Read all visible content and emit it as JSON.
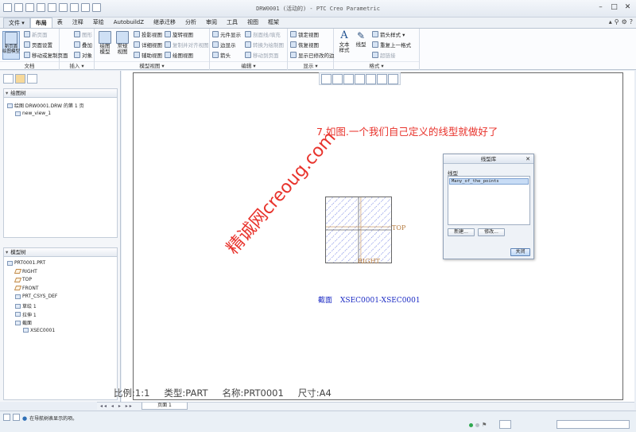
{
  "window": {
    "title": "DRW0001 (活动的) - PTC Creo Parametric"
  },
  "menu_tabs": [
    {
      "label": "文件 ▾",
      "state": "file"
    },
    {
      "label": "布局",
      "state": "active"
    },
    {
      "label": "表",
      "state": ""
    },
    {
      "label": "注释",
      "state": ""
    },
    {
      "label": "草绘",
      "state": ""
    },
    {
      "label": "AutobuildZ",
      "state": ""
    },
    {
      "label": "继承迁移",
      "state": ""
    },
    {
      "label": "分析",
      "state": ""
    },
    {
      "label": "审阅",
      "state": ""
    },
    {
      "label": "工具",
      "state": ""
    },
    {
      "label": "视图",
      "state": ""
    },
    {
      "label": "框架",
      "state": ""
    }
  ],
  "ribbon": {
    "doc_group": {
      "label": "文档",
      "big": "新页面\n绘图模型",
      "items": [
        "新页面",
        "页面设置",
        "移动或复制页面"
      ]
    },
    "insert_group": {
      "label": "插入 ▾",
      "items": [
        "图形",
        "叠加",
        "对象"
      ]
    },
    "model_views_group": {
      "label": "模型视图 ▾",
      "big1": "绘图\n模型",
      "big2": "常规\n视图",
      "items": [
        "投影视图",
        "旋转视图",
        "详细视图",
        "复制并对齐视图",
        "辅助视图",
        "绘图视图"
      ]
    },
    "edit_group": {
      "label": "编辑 ▾",
      "items": [
        "元件显示",
        "箭头",
        "边显示",
        "转换为绘制图",
        "剖面线/填充",
        "移动到页面"
      ]
    },
    "display_group": {
      "label": "显示 ▾",
      "items": [
        "锁定视图",
        "恢复视图",
        "显示已修改的边"
      ]
    },
    "format_group": {
      "label": "格式 ▾",
      "big1": "文本\n样式",
      "big2": "线型",
      "items": [
        "箭头样式 ▾",
        "重复上一格式",
        "超链接"
      ]
    }
  },
  "drawing_tree": {
    "header": "绘图树",
    "items": [
      "绘图 DRW0001.DRW 的第 1 页",
      "new_view_1"
    ]
  },
  "model_tree": {
    "header": "模型树",
    "items": [
      {
        "label": "PRT0001.PRT",
        "icon": "part-icon"
      },
      {
        "label": "RIGHT",
        "icon": "datum-plane-icon"
      },
      {
        "label": "TOP",
        "icon": "datum-plane-icon"
      },
      {
        "label": "FRONT",
        "icon": "datum-plane-icon"
      },
      {
        "label": "PRT_CSYS_DEF",
        "icon": "csys-icon"
      },
      {
        "label": "草绘 1",
        "icon": "sketch-icon"
      },
      {
        "label": "拉伸 1",
        "icon": "extrude-icon"
      },
      {
        "label": "截面",
        "icon": "section-folder-icon"
      },
      {
        "label": "XSEC0001",
        "icon": "section-icon"
      }
    ]
  },
  "canvas": {
    "instruction": "7.如图.一个我们自己定义的线型就做好了",
    "label_top": "TOP",
    "label_right": "RIGHT",
    "caption_label": "截面",
    "caption_name": "XSEC0001-XSEC0001",
    "watermark": "精诚网creoug.com",
    "hatch_color": "#2a3fd4",
    "instruction_color": "#e8322b"
  },
  "dialog": {
    "title": "线型库",
    "close": "✕",
    "list_label": "线型",
    "selected_item": "Many_of_the_points",
    "new_button": "新建...",
    "modify_button": "修改...",
    "close_button": "关闭"
  },
  "sheet_info": {
    "scale": "比例:1:1",
    "type": "类型:PART",
    "name": "名称:PRT0001",
    "size": "尺寸:A4"
  },
  "page_bar": {
    "nav": "◂◂ ◂ ▸ ▸▸",
    "page_tab": "页面 1"
  },
  "status": {
    "message": "在导航树表显示的项。"
  }
}
